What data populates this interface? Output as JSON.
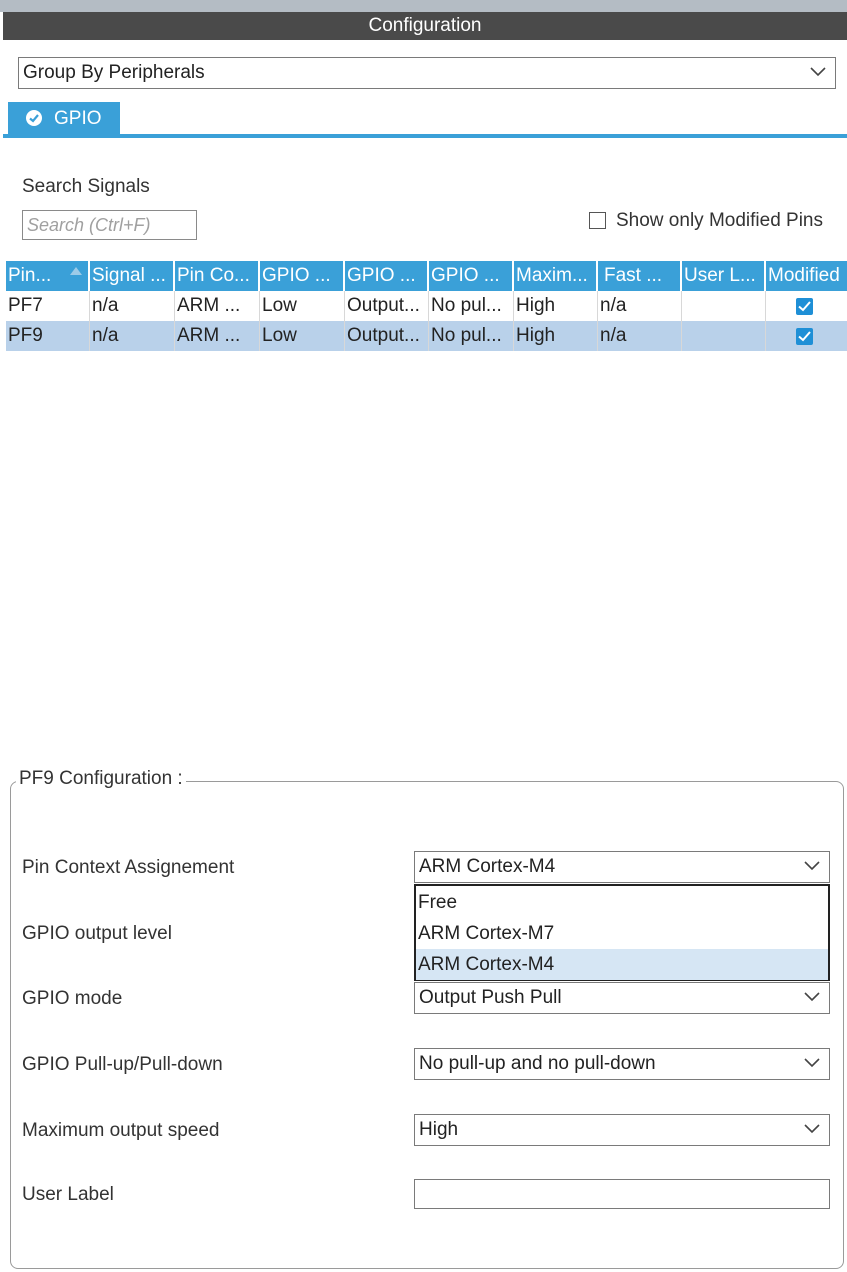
{
  "window": {
    "title": "Configuration"
  },
  "group_by": {
    "value": "Group By Peripherals"
  },
  "tabs": [
    {
      "label": "GPIO",
      "status": "ok"
    }
  ],
  "search": {
    "label": "Search Signals",
    "placeholder": "Search (Ctrl+F)"
  },
  "filter": {
    "label": "Show only Modified Pins",
    "checked": false
  },
  "table": {
    "columns": [
      "Pin...",
      "Signal ...",
      "Pin Co...",
      "GPIO ...",
      "GPIO ...",
      "GPIO ...",
      "Maxim...",
      "Fast ...",
      "User L...",
      "Modified"
    ],
    "sorted_column": "Pin...",
    "rows": [
      {
        "cells": [
          "PF7",
          "n/a",
          "ARM ...",
          "Low",
          "Output...",
          "No pul...",
          "High",
          "n/a",
          ""
        ],
        "modified": true,
        "selected": false
      },
      {
        "cells": [
          "PF9",
          "n/a",
          "ARM ...",
          "Low",
          "Output...",
          "No pul...",
          "High",
          "n/a",
          ""
        ],
        "modified": true,
        "selected": true
      }
    ]
  },
  "config": {
    "title": "PF9 Configuration :",
    "fields": {
      "pin_context": {
        "label": "Pin Context Assignement",
        "value": "ARM Cortex-M4"
      },
      "output_level": {
        "label": "GPIO output level"
      },
      "mode": {
        "label": "GPIO mode",
        "value": "Output Push Pull"
      },
      "pull": {
        "label": "GPIO Pull-up/Pull-down",
        "value": "No pull-up and no pull-down"
      },
      "speed": {
        "label": "Maximum output speed",
        "value": "High"
      },
      "user_label": {
        "label": "User Label",
        "value": ""
      }
    },
    "dropdown_options": [
      "Free",
      "ARM Cortex-M7",
      "ARM Cortex-M4"
    ],
    "dropdown_highlighted": "ARM Cortex-M4"
  },
  "colors": {
    "accent": "#3aa0d8",
    "title_bar": "#4a4a4a",
    "selected_row": "#b9d1ea",
    "check": "#1e8fd6"
  }
}
